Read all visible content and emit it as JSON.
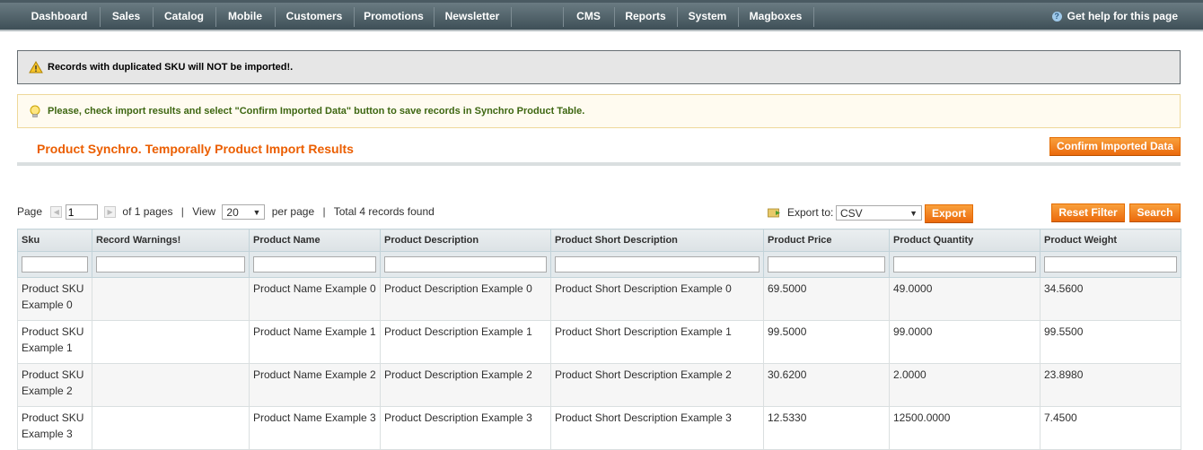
{
  "nav": {
    "items": [
      "Dashboard",
      "Sales",
      "Catalog",
      "Mobile",
      "Customers",
      "Promotions",
      "Newsletter",
      "CMS",
      "Reports",
      "System",
      "Magboxes"
    ],
    "help": "Get help for this page"
  },
  "messages": {
    "warning": "Records with duplicated SKU will NOT be imported!.",
    "notice": "Please, check import results and select \"Confirm Imported Data\" button to save records in Synchro Product Table."
  },
  "header": {
    "title": "Product Synchro. Temporally Product Import Results",
    "confirm_label": "Confirm Imported Data"
  },
  "pager": {
    "page_label": "Page",
    "page_value": "1",
    "of_pages": "of 1 pages",
    "view_label": "View",
    "per_page_value": "20",
    "per_page_label": "per page",
    "total": "Total 4 records found"
  },
  "export": {
    "label": "Export to:",
    "format": "CSV",
    "button": "Export"
  },
  "filters": {
    "reset": "Reset Filter",
    "search": "Search"
  },
  "grid": {
    "columns": [
      "Sku",
      "Record Warnings!",
      "Product Name",
      "Product Description",
      "Product Short Description",
      "Product Price",
      "Product Quantity",
      "Product Weight"
    ],
    "rows": [
      [
        "Product SKU Example 0",
        "",
        "Product Name Example 0",
        "Product Description Example 0",
        "Product Short Description Example 0",
        "69.5000",
        "49.0000",
        "34.5600"
      ],
      [
        "Product SKU Example 1",
        "",
        "Product Name Example 1",
        "Product Description Example 1",
        "Product Short Description Example 1",
        "99.5000",
        "99.0000",
        "99.5500"
      ],
      [
        "Product SKU Example 2",
        "",
        "Product Name Example 2",
        "Product Description Example 2",
        "Product Short Description Example 2",
        "30.6200",
        "2.0000",
        "23.8980"
      ],
      [
        "Product SKU Example 3",
        "",
        "Product Name Example 3",
        "Product Description Example 3",
        "Product Short Description Example 3",
        "12.5330",
        "12500.0000",
        "7.4500"
      ]
    ]
  },
  "colors": {
    "accent": "#eb5e00",
    "nav_bg": "#4e5f67",
    "notice_text": "#3d6611"
  },
  "icons": {
    "warning": "warning-icon",
    "notice": "lightbulb-icon",
    "help": "help-icon",
    "export": "export-folder-icon"
  }
}
